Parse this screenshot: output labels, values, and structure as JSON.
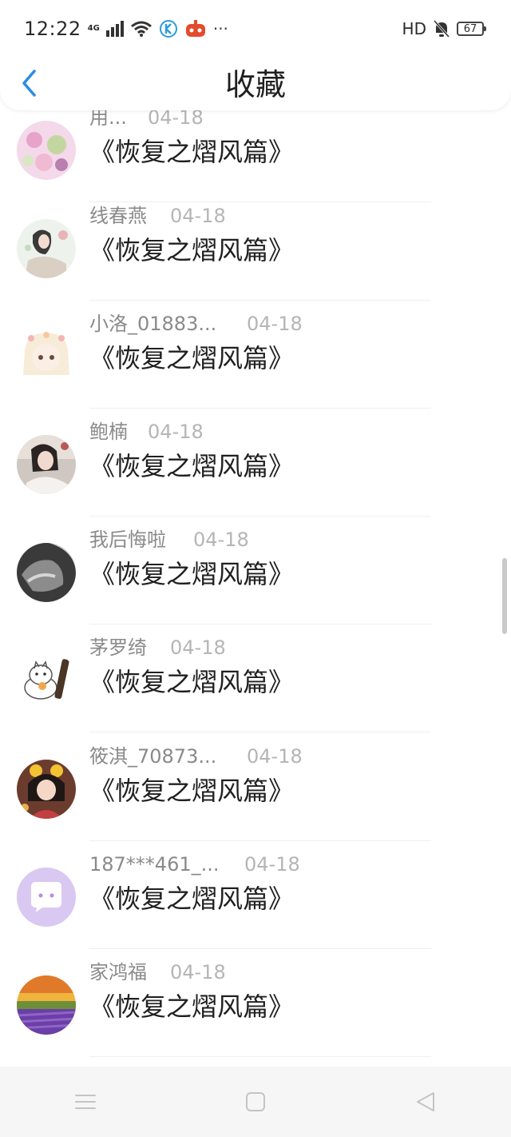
{
  "status_bar": {
    "time": "12:22",
    "network": "4G",
    "hd": "HD",
    "battery": "67",
    "more": "···",
    "icons": [
      "signal-icon",
      "wifi-icon",
      "app-k-icon",
      "app-red-icon",
      "mute-icon",
      "battery-icon"
    ]
  },
  "header": {
    "title": "收藏",
    "back_icon": "chevron-left-icon",
    "accent": "#2b8ce6"
  },
  "favorites": [
    {
      "name": "用...",
      "date": "04-18",
      "title": "《恢复之熠风篇》"
    },
    {
      "name": "线春燕",
      "date": "04-18",
      "title": "《恢复之熠风篇》"
    },
    {
      "name": "小洛_01883...",
      "date": "04-18",
      "title": "《恢复之熠风篇》"
    },
    {
      "name": "鲍楠",
      "date": "04-18",
      "title": "《恢复之熠风篇》"
    },
    {
      "name": "我后悔啦",
      "date": "04-18",
      "title": "《恢复之熠风篇》"
    },
    {
      "name": "茅罗绮",
      "date": "04-18",
      "title": "《恢复之熠风篇》"
    },
    {
      "name": "筱淇_70873...",
      "date": "04-18",
      "title": "《恢复之熠风篇》"
    },
    {
      "name": "187***461_...",
      "date": "04-18",
      "title": "《恢复之熠风篇》"
    },
    {
      "name": "家鸿福",
      "date": "04-18",
      "title": "《恢复之熠风篇》"
    }
  ],
  "nav_bar": {
    "icons": [
      "menu-icon",
      "home-icon",
      "back-triangle-icon"
    ]
  }
}
